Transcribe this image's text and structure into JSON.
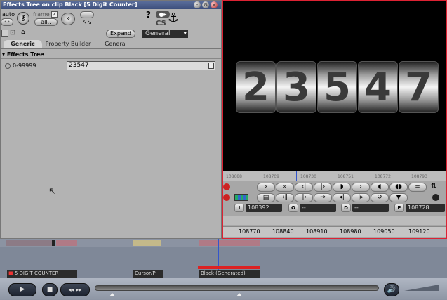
{
  "effects_panel": {
    "title": "Effects Tree on clip Black [5 Digit Counter]",
    "auto_label": "auto",
    "frame_label": "frame",
    "all_label": "all..",
    "expand_label": "Expand",
    "general_select": "General",
    "help_label": "?",
    "tabs": [
      "Generic",
      "Property Builder",
      "General"
    ],
    "tree_header": "Effects Tree",
    "param_name": "0-99999",
    "param_value": "23547"
  },
  "viewer": {
    "digits": [
      "2",
      "3",
      "5",
      "4",
      "7"
    ]
  },
  "controls": {
    "ruler_ticks": [
      "108688",
      "108709",
      "108730",
      "108751",
      "108772",
      "108793"
    ],
    "row1": [
      "«",
      "»",
      "‹|",
      "|›",
      "◗",
      "›",
      "◖",
      "◖◗"
    ],
    "row2": [
      "▤",
      "‹‖",
      "‖›",
      "→",
      "◂|",
      "|▸",
      "↺",
      "▼"
    ],
    "in_label": "I",
    "in_value": "108392",
    "out_label": "O",
    "out_value": "--",
    "dur_label": "D",
    "dur_value": "--",
    "pos_label": "P",
    "pos_value": "108728",
    "lower_ticks": [
      "108770",
      "108840",
      "108910",
      "108980",
      "109050",
      "109120"
    ]
  },
  "timeline": {
    "clip1": "5 DIGIT COUNTER",
    "clip2": "Cursor/P",
    "clip3": "Black (Generated)"
  },
  "bottom": {
    "play_label": "▶",
    "stop_label": "■",
    "rew_label": "◂◂",
    "ffw_label": "▸▸",
    "volume_icon_label": "🔊"
  }
}
